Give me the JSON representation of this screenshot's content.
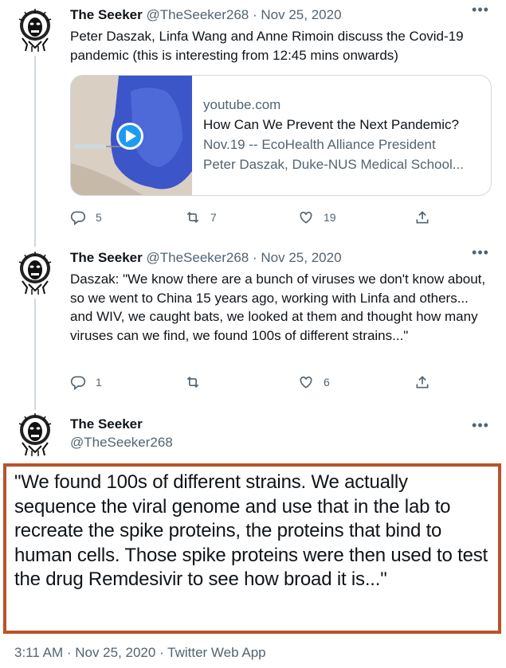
{
  "tweets": [
    {
      "name": "The Seeker",
      "handle": "@TheSeeker268",
      "sep": "·",
      "date": "Nov 25, 2020",
      "text": "Peter Daszak, Linfa Wang and Anne Rimoin discuss the Covid-19 pandemic (this is interesting from 12:45 mins onwards)",
      "card": {
        "domain": "youtube.com",
        "title": "How Can We Prevent the Next Pandemic?",
        "desc_line1": "Nov.19 -- EcoHealth Alliance President",
        "desc_line2": "Peter Daszak, Duke-NUS Medical School..."
      },
      "actions": {
        "replies": "5",
        "retweets": "7",
        "likes": "19"
      }
    },
    {
      "name": "The Seeker",
      "handle": "@TheSeeker268",
      "sep": "·",
      "date": "Nov 25, 2020",
      "text": "Daszak: \"We know there are a bunch of viruses we don't know about, so we went to China 15 years ago, working with Linfa and others... and WIV, we caught bats, we looked at them and thought how many viruses can we find, we found 100s of different strains...\"",
      "actions": {
        "replies": "1",
        "retweets": "",
        "likes": "6"
      }
    }
  ],
  "focus_tweet": {
    "name": "The Seeker",
    "handle": "@TheSeeker268",
    "text": "\"We found 100s of different strains. We actually sequence the viral genome and use that in the lab to recreate the spike proteins, the proteins that bind to human cells. Those spike proteins were then used to test the drug Remdesivir to see how broad it is...\"",
    "footer": "3:11 AM · Nov 25, 2020 · Twitter Web App"
  },
  "colors": {
    "highlight_border": "#b8532a",
    "muted": "#536471",
    "play_button": "#1d9bf0"
  },
  "icons": [
    "more-icon",
    "reply-icon",
    "retweet-icon",
    "like-icon",
    "share-icon",
    "play-icon"
  ]
}
